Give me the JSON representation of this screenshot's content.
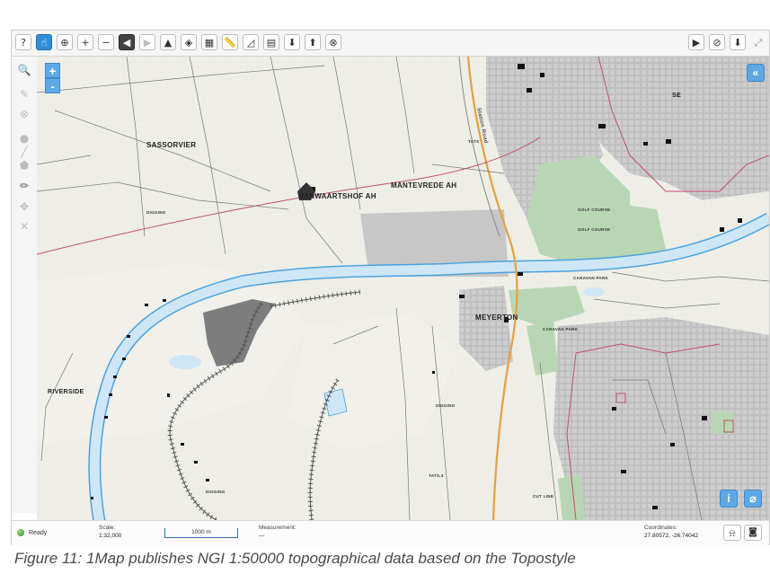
{
  "toolbar": {
    "left_tools": [
      {
        "icon": "help-icon",
        "glyph": "?"
      },
      {
        "icon": "pointer-icon",
        "glyph": "☝"
      },
      {
        "icon": "globe-icon",
        "glyph": "⊕"
      },
      {
        "icon": "zoom-in-icon",
        "glyph": "+"
      },
      {
        "icon": "zoom-out-icon",
        "glyph": "−"
      },
      {
        "icon": "previous-extent-icon",
        "glyph": "◀"
      },
      {
        "icon": "next-extent-icon",
        "glyph": "▶"
      },
      {
        "icon": "terrain-icon",
        "glyph": "▲"
      },
      {
        "icon": "locate-icon",
        "glyph": "◈"
      },
      {
        "icon": "grid-icon",
        "glyph": "▦"
      },
      {
        "icon": "measure-ruler-icon",
        "glyph": "📏"
      },
      {
        "icon": "measure-area-icon",
        "glyph": "◿"
      },
      {
        "icon": "pdf-icon",
        "glyph": "▤"
      },
      {
        "icon": "download-icon",
        "glyph": "⬇"
      },
      {
        "icon": "upload-icon",
        "glyph": "⬆"
      },
      {
        "icon": "basemap-globe-icon",
        "glyph": "⊗"
      }
    ],
    "right_tools": [
      {
        "icon": "play-tour-icon",
        "glyph": "▶"
      },
      {
        "icon": "no-layers-icon",
        "glyph": "⊘"
      },
      {
        "icon": "download-map-icon",
        "glyph": "⬇"
      },
      {
        "icon": "fullscreen-icon",
        "glyph": "⤢"
      }
    ]
  },
  "left_panel": [
    {
      "icon": "zoom-box-icon",
      "glyph": "🔍",
      "enabled": true
    },
    {
      "icon": "edit-layer-icon",
      "glyph": "✎",
      "enabled": false
    },
    {
      "icon": "cancel-icon",
      "glyph": "⊗",
      "enabled": false
    },
    {
      "icon": "point-icon",
      "glyph": "●",
      "enabled": false
    },
    {
      "icon": "line-icon",
      "glyph": "╱",
      "enabled": false
    },
    {
      "icon": "polygon-icon",
      "glyph": "⬟",
      "enabled": false
    },
    {
      "icon": "pencil-icon",
      "glyph": "✏",
      "enabled": true
    },
    {
      "icon": "move-icon",
      "glyph": "✥",
      "enabled": false
    },
    {
      "icon": "delete-icon",
      "glyph": "✕",
      "enabled": false
    }
  ],
  "map": {
    "zoom_in": "+",
    "zoom_out": "-",
    "collapse_label": "«",
    "info_label": "i",
    "attach_label": "⌀",
    "labels": {
      "sassorivier": "SASSORVIER",
      "vanwaartshof": "VANWAARTSHOF AH",
      "mantevrede": "MANTEVREDE AH",
      "riverside": "RIVERSIDE",
      "meyerton": "MEYERTON",
      "se": "SE",
      "station_road": "Station Road",
      "golf1": "GOLF COURSE",
      "golf2": "GOLF COURSE",
      "caravan1": "CARAVAN PARK",
      "caravan2": "CARAVAN PARK",
      "digging1": "DIGGING",
      "digging2": "DIGGING",
      "digging3": "DIGGING",
      "cutline": "CUT LINE",
      "t1": "TATS.3",
      "t2": "TATS"
    },
    "colors": {
      "land": "#f1f0ea",
      "water": "#cfe6f7",
      "river_edge": "#4aa3e0",
      "urban": "#c9c9c9",
      "park": "#b8d6b4",
      "road_main": "#e8a040",
      "boundary": "#c0506a"
    }
  },
  "status": {
    "ready": "Ready",
    "scale_label": "Scale:",
    "scale_value": "1:32,000",
    "scalebar_text": "1000 m",
    "measurement_label": "Measurement:",
    "measurement_value": "---",
    "coords_label": "Coordinates:",
    "coords_value": "27.80572, -26.74042"
  },
  "caption": "Figure 11: 1Map publishes NGI 1:50000 topographical data based on the Topostyle"
}
